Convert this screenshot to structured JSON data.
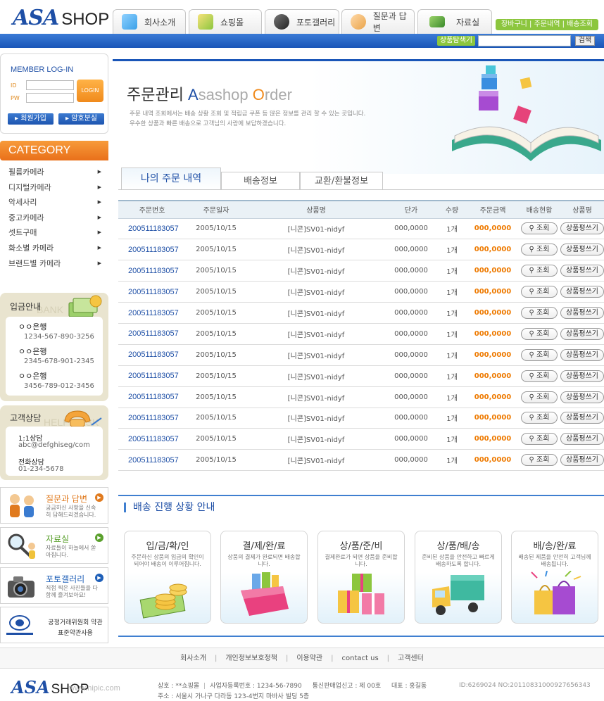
{
  "header": {
    "logo_main": "ASA",
    "logo_sub": "SHOP",
    "nav": [
      {
        "label": "회사소개",
        "icon": "building-icon"
      },
      {
        "label": "쇼핑몰",
        "icon": "shopping-bag-icon"
      },
      {
        "label": "포토갤러리",
        "icon": "camera-icon"
      },
      {
        "label": "질문과 답변",
        "icon": "question-people-icon"
      },
      {
        "label": "자료실",
        "icon": "monitor-icon"
      }
    ],
    "top_links": [
      "장바구니",
      "주문내역",
      "배송조회"
    ],
    "search_label": "상품탐색기",
    "search_value": "",
    "search_button": "검색"
  },
  "login": {
    "title": "MEMBER LOG-IN",
    "id_label": "ID",
    "pw_label": "PW",
    "login_button": "LOGIN",
    "join_button": "회원가입",
    "find_pw_button": "암호분실"
  },
  "category": {
    "title": "CATEGORY",
    "items": [
      "필름카메라",
      "디지털카메라",
      "악세사리",
      "중고카메라",
      "셋트구매",
      "화소별 카메라",
      "브랜드별 카메라"
    ]
  },
  "deposit": {
    "title": "입금안내",
    "watermark": "BANK",
    "banks": [
      {
        "name": "ㅇㅇ은행",
        "number": "1234-567-890-3256"
      },
      {
        "name": "ㅇㅇ은행",
        "number": "2345-678-901-2345"
      },
      {
        "name": "ㅇㅇ은행",
        "number": "3456-789-012-3456"
      }
    ]
  },
  "support": {
    "title": "고객상담",
    "watermark": "HELP DESK",
    "one_to_one_label": "1:1상담",
    "email": "abc@defghiseg/com",
    "phone_label": "전화상담",
    "phone": "01-234-5678"
  },
  "promos": [
    {
      "title": "질문과 답변",
      "desc": "궁금하신 사항을 신속히 답해드리겠습니다.",
      "color": "#e07a1e",
      "icon": "people-icon"
    },
    {
      "title": "자료실",
      "desc": "자료들이 하늘에서 쏟아집니다.",
      "color": "#5aa02c",
      "icon": "magnifier-icon"
    },
    {
      "title": "포토갤러리",
      "desc": "직접 찍은 사진들을 다함께 즐겨보아요!",
      "color": "#1e5fb8",
      "icon": "camera-icon"
    }
  ],
  "ftc": {
    "line1": "공정거래위원회 약관",
    "line2": "표준약관사용",
    "icon": "ftc-seal-icon"
  },
  "main": {
    "title": "주문관리",
    "title_en_prefix": "A",
    "title_en_mid": "sashop ",
    "title_en_o": "O",
    "title_en_end": "rder",
    "desc1": "주문 내역 조회에서는 배송 상황 조회 및 적립금 쿠폰 등 많은 정보를 관리 할 수 있는 곳입니다.",
    "desc2": "우수한 상품과 빠른 배송으로 고객님의 사랑에 보답하겠습니다.",
    "tabs": [
      "나의 주문 내역",
      "배송정보",
      "교환/환불정보"
    ]
  },
  "table": {
    "headers": [
      "주문번호",
      "주문일자",
      "상품명",
      "단가",
      "수량",
      "주문금액",
      "배송현황",
      "상품평"
    ],
    "view_label": "조회",
    "review_label": "상품평쓰기",
    "rows": [
      {
        "order_no": "200511183057",
        "date": "2005/10/15",
        "product": "[니콘]SV01-nidyf",
        "unit_price": "000,0000",
        "qty": "1개",
        "amount": "000,0000"
      },
      {
        "order_no": "200511183057",
        "date": "2005/10/15",
        "product": "[니콘]SV01-nidyf",
        "unit_price": "000,0000",
        "qty": "1개",
        "amount": "000,0000"
      },
      {
        "order_no": "200511183057",
        "date": "2005/10/15",
        "product": "[니콘]SV01-nidyf",
        "unit_price": "000,0000",
        "qty": "1개",
        "amount": "000,0000"
      },
      {
        "order_no": "200511183057",
        "date": "2005/10/15",
        "product": "[니콘]SV01-nidyf",
        "unit_price": "000,0000",
        "qty": "1개",
        "amount": "000,0000"
      },
      {
        "order_no": "200511183057",
        "date": "2005/10/15",
        "product": "[니콘]SV01-nidyf",
        "unit_price": "000,0000",
        "qty": "1개",
        "amount": "000,0000"
      },
      {
        "order_no": "200511183057",
        "date": "2005/10/15",
        "product": "[니콘]SV01-nidyf",
        "unit_price": "000,0000",
        "qty": "1개",
        "amount": "000,0000"
      },
      {
        "order_no": "200511183057",
        "date": "2005/10/15",
        "product": "[니콘]SV01-nidyf",
        "unit_price": "000,0000",
        "qty": "1개",
        "amount": "000,0000"
      },
      {
        "order_no": "200511183057",
        "date": "2005/10/15",
        "product": "[니콘]SV01-nidyf",
        "unit_price": "000,0000",
        "qty": "1개",
        "amount": "000,0000"
      },
      {
        "order_no": "200511183057",
        "date": "2005/10/15",
        "product": "[니콘]SV01-nidyf",
        "unit_price": "000,0000",
        "qty": "1개",
        "amount": "000,0000"
      },
      {
        "order_no": "200511183057",
        "date": "2005/10/15",
        "product": "[니콘]SV01-nidyf",
        "unit_price": "000,0000",
        "qty": "1개",
        "amount": "000,0000"
      },
      {
        "order_no": "200511183057",
        "date": "2005/10/15",
        "product": "[니콘]SV01-nidyf",
        "unit_price": "000,0000",
        "qty": "1개",
        "amount": "000,0000"
      },
      {
        "order_no": "200511183057",
        "date": "2005/10/15",
        "product": "[니콘]SV01-nidyf",
        "unit_price": "000,0000",
        "qty": "1개",
        "amount": "000,0000"
      }
    ]
  },
  "shipping": {
    "title": "배송 진행 상황 안내",
    "steps": [
      {
        "title": "입/금/확/인",
        "desc": "주문하신 상품의 입금의 확인이 되어야 배송이 이루어집니다.",
        "icon": "coins-icon"
      },
      {
        "title": "결/제/완/료",
        "desc": "상품의 결제가 완료되면 배송합니다.",
        "icon": "wallet-icon"
      },
      {
        "title": "상/품/준/비",
        "desc": "결제완료가 되면 상품을 준비합니다.",
        "icon": "gift-boxes-icon"
      },
      {
        "title": "상/품/배/송",
        "desc": "준비된 상품을 안전하고 빠르게 배송하도록 합니다.",
        "icon": "truck-icon"
      },
      {
        "title": "배/송/완/료",
        "desc": "배송된 제품을 안전히 고객님께 배송됩니다.",
        "icon": "shopping-bags-icon"
      }
    ]
  },
  "footer": {
    "links": [
      "회사소개",
      "개인정보보호정책",
      "이용약관",
      "contact us",
      "고객센터"
    ],
    "logo_main": "ASA",
    "logo_sub": "SHOP",
    "mark": "www.nipic.com",
    "company": "상호 : **쇼핑몰",
    "biz_no": "사업자등록번호 : 1234-56-7890",
    "mail_order": "통신판매업신고 : 제 00호",
    "ceo": "대표 : 홍길동",
    "address": "주소 : 서울시 가나구 다라동 123-4번지 마바사 빌딩 5층",
    "image_id": "ID:6269024 NO:20110831000927656343"
  }
}
